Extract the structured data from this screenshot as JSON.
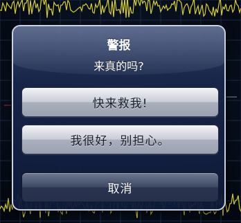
{
  "alert": {
    "title": "警报",
    "message": "来真的吗?",
    "buttons": [
      {
        "label": "快来救我!"
      },
      {
        "label": "我很好，别担心。"
      }
    ],
    "cancel_label": "取消"
  },
  "colors": {
    "waveform": "#d8d02a",
    "grid": "#1d2a44",
    "accent_line": "#c0283a"
  }
}
